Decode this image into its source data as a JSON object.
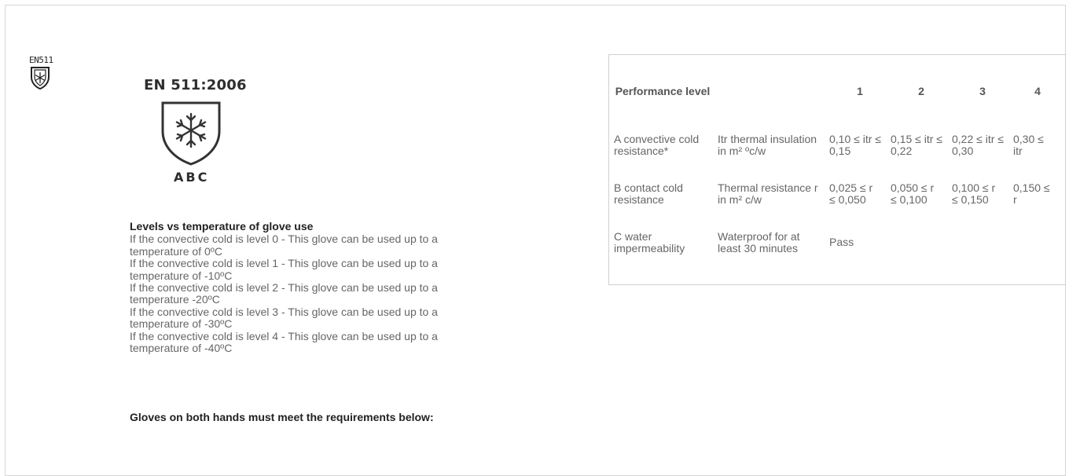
{
  "small_logo": {
    "code": "EN511",
    "icon": "snowflake-shield-icon"
  },
  "big_logo": {
    "standard": "EN 511:2006",
    "icon": "snowflake-shield-icon",
    "letters": "ABC"
  },
  "levels": {
    "title": "Levels vs temperature of glove use",
    "lines": [
      "If the convective cold is level 0 - This glove can be used up to a",
      "temperature of 0ºC",
      "If the convective cold is level 1 - This glove can be used up to a",
      "temperature of -10ºC",
      "If the convective cold is level 2 - This glove can be used up to a",
      "temperature -20ºC",
      "If the convective cold is level 3 - This glove can be used up to a",
      "temperature of -30ºC",
      "If the convective cold is level 4 - This glove can be used up to a",
      "temperature of -40ºC"
    ]
  },
  "note": "Gloves on both hands must meet the requirements below:",
  "performance_table": {
    "header": {
      "label": "Performance level",
      "levels": [
        "1",
        "2",
        "3",
        "4"
      ]
    },
    "rows": [
      {
        "name": "A convective cold resistance*",
        "description": "Itr thermal insulation in m² ºc/w",
        "values": [
          "0,10 ≤ itr ≤ 0,15",
          "0,15 ≤ itr ≤ 0,22",
          "0,22 ≤ itr ≤ 0,30",
          "0,30 ≤ itr"
        ]
      },
      {
        "name": "B contact cold resistance",
        "description": "Thermal resistance r in m² c/w",
        "values": [
          "0,025 ≤ r ≤ 0,050",
          "0,050 ≤ r ≤ 0,100",
          "0,100 ≤ r ≤ 0,150",
          "0,150 ≤ r"
        ]
      },
      {
        "name": "C water impermeability",
        "description": "Waterproof for at least 30 minutes",
        "values": [
          "Pass",
          "",
          "",
          ""
        ]
      }
    ]
  }
}
